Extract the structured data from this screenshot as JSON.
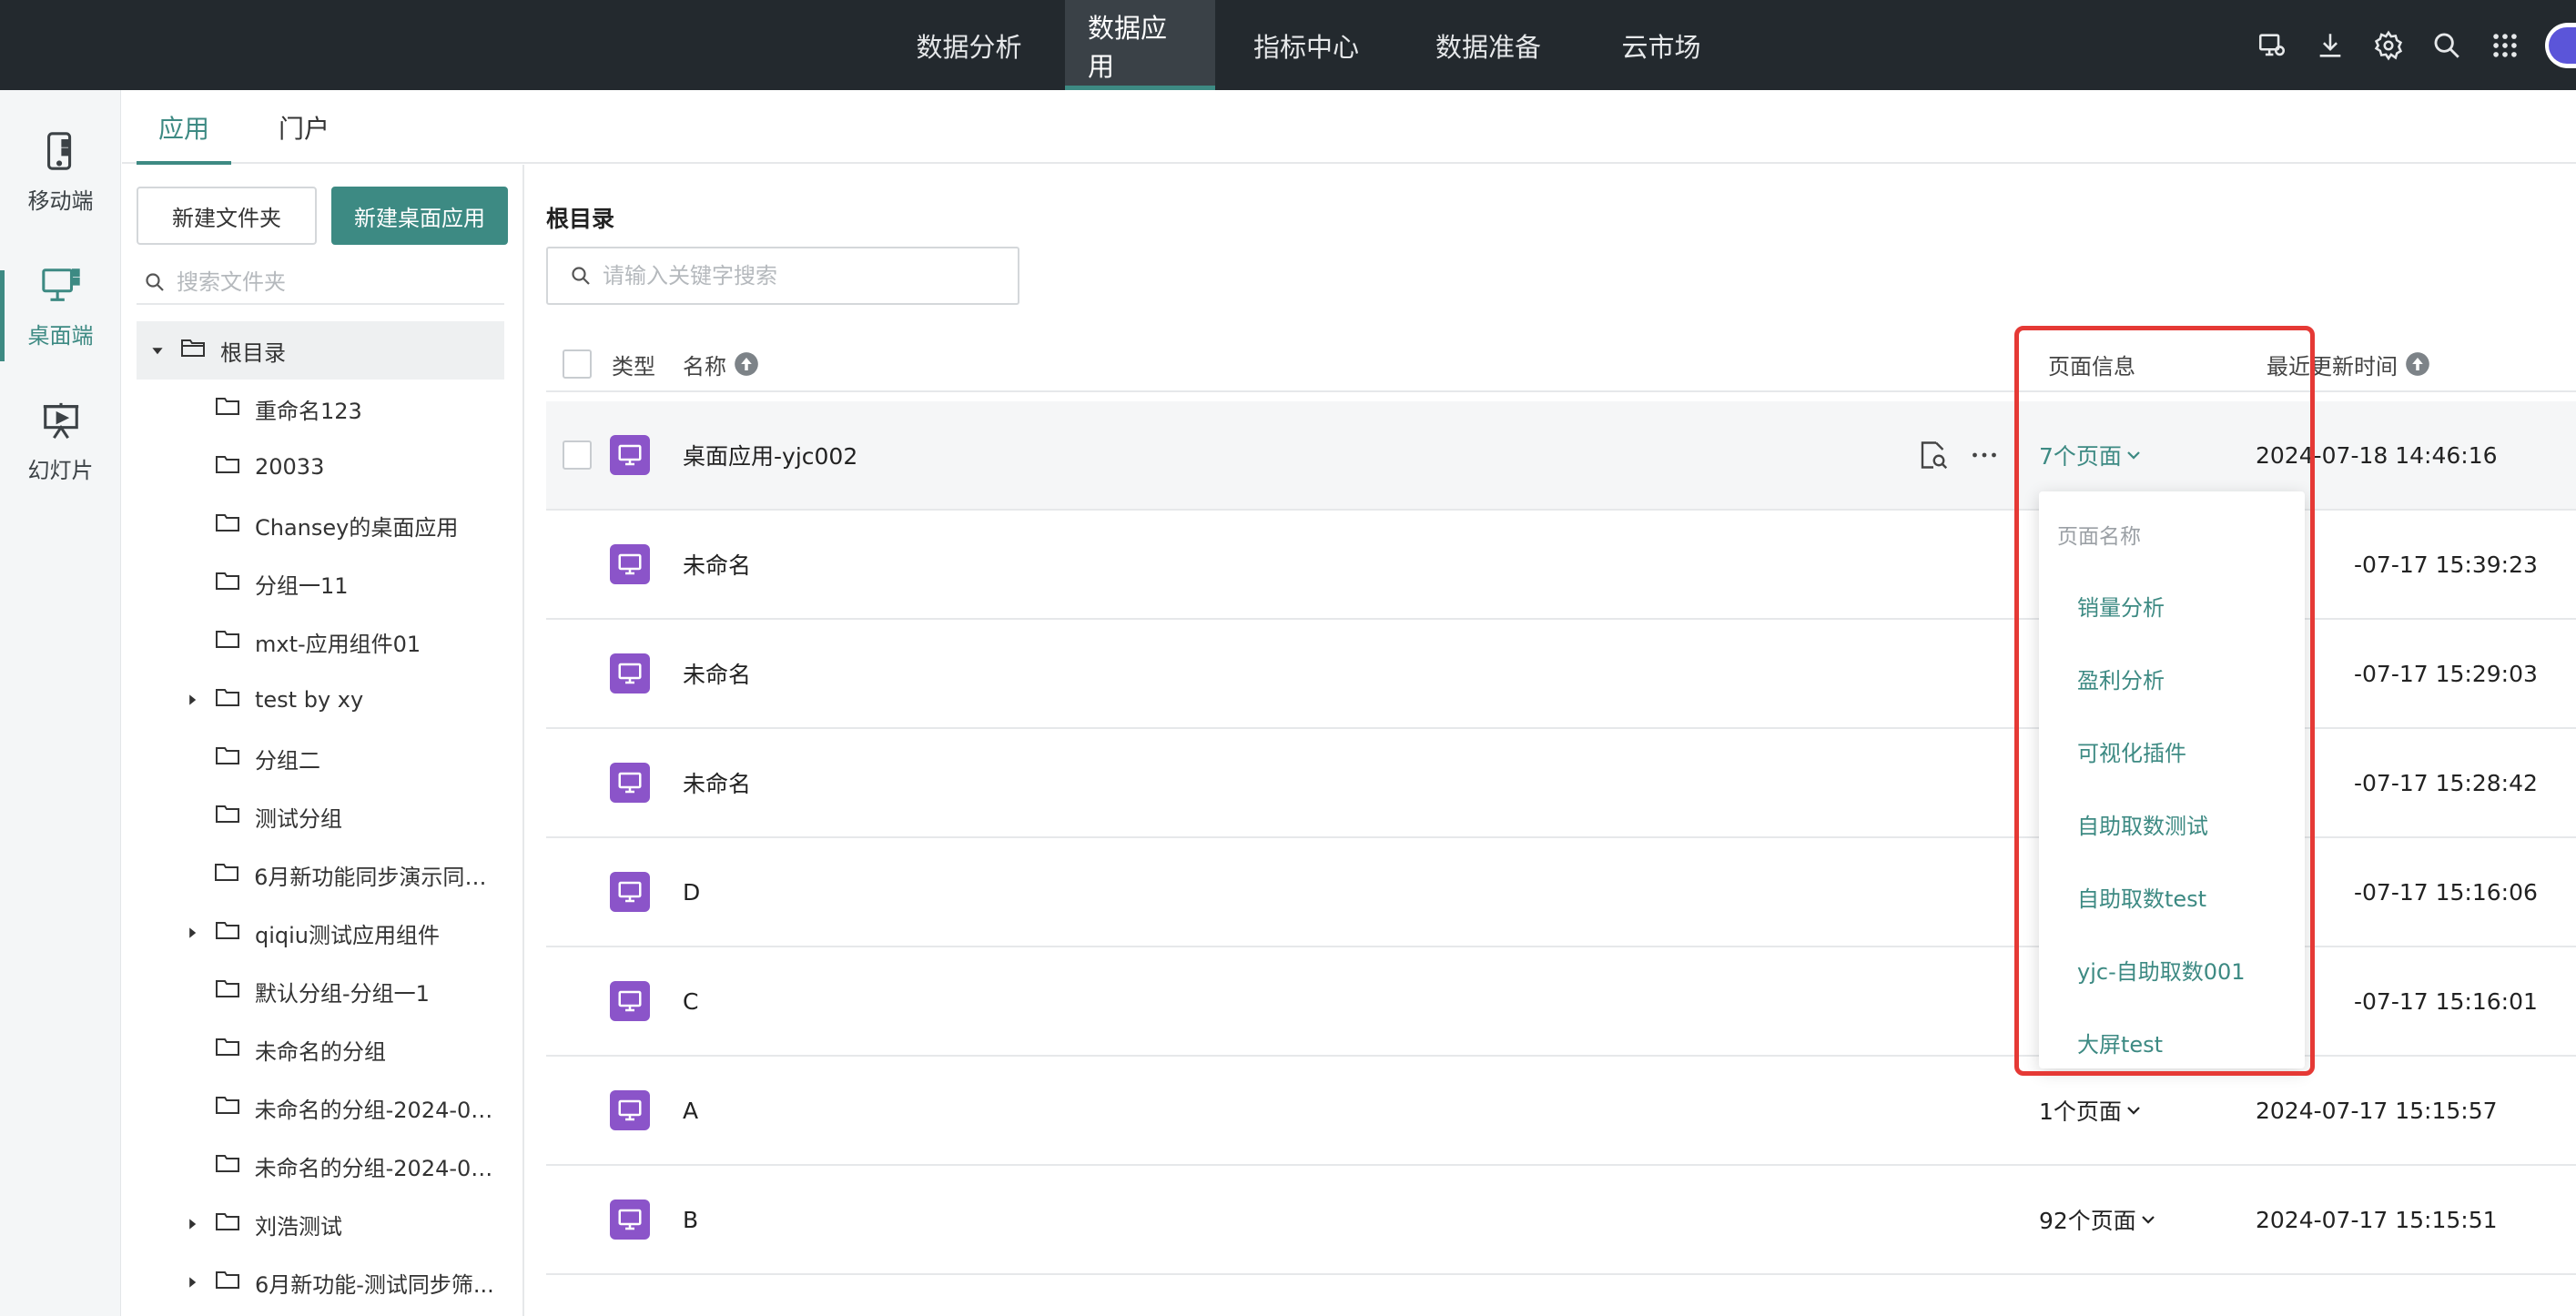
{
  "topbar": {
    "nav": [
      "数据分析",
      "数据应用",
      "指标中心",
      "数据准备",
      "云市场"
    ],
    "active_nav": "数据应用",
    "icons": [
      "monitor-settings-icon",
      "download-icon",
      "settings-icon",
      "search-icon",
      "apps-grid-icon",
      "avatar"
    ]
  },
  "rail": {
    "items": [
      {
        "label": "移动端",
        "icon": "mobile-icon"
      },
      {
        "label": "桌面端",
        "icon": "desktop-icon",
        "active": true
      },
      {
        "label": "幻灯片",
        "icon": "slideshow-icon"
      }
    ]
  },
  "subtabs": {
    "app": "应用",
    "portal": "门户",
    "active": "应用"
  },
  "folder_panel": {
    "new_folder_label": "新建文件夹",
    "new_desktop_app_label": "新建桌面应用",
    "search_placeholder": "搜索文件夹",
    "tree": [
      {
        "label": "根目录",
        "level": 0,
        "expanded": true,
        "selected": true
      },
      {
        "label": "重命名123",
        "level": 1
      },
      {
        "label": "20033",
        "level": 1
      },
      {
        "label": "Chansey的桌面应用",
        "level": 1
      },
      {
        "label": "分组一11",
        "level": 1
      },
      {
        "label": "mxt-应用组件01",
        "level": 1
      },
      {
        "label": "test by xy",
        "level": 1,
        "collapsed": true
      },
      {
        "label": "分组二",
        "level": 1
      },
      {
        "label": "测试分组",
        "level": 1
      },
      {
        "label": "6月新功能同步演示同步...",
        "level": 1
      },
      {
        "label": "qiqiu测试应用组件",
        "level": 1,
        "collapsed": true
      },
      {
        "label": "默认分组-分组一1",
        "level": 1
      },
      {
        "label": "未命名的分组",
        "level": 1
      },
      {
        "label": "未命名的分组-2024-06...",
        "level": 1
      },
      {
        "label": "未命名的分组-2024-06...",
        "level": 1
      },
      {
        "label": "刘浩测试",
        "level": 1,
        "collapsed": true
      },
      {
        "label": "6月新功能-测试同步筛...",
        "level": 1,
        "collapsed": true
      }
    ]
  },
  "main": {
    "breadcrumb": "根目录",
    "search_placeholder": "请输入关键字搜索",
    "columns": {
      "type": "类型",
      "name": "名称",
      "page_info": "页面信息",
      "updated": "最近更新时间"
    },
    "rows": [
      {
        "name": "桌面应用-yjc002",
        "pages": "7个页面",
        "updated": "2024-07-18 14:46:16",
        "hover": true
      },
      {
        "name": "未命名",
        "pages": "",
        "updated": "-07-17 15:39:23"
      },
      {
        "name": "未命名",
        "pages": "",
        "updated": "-07-17 15:29:03"
      },
      {
        "name": "未命名",
        "pages": "",
        "updated": "-07-17 15:28:42"
      },
      {
        "name": "D",
        "pages": "",
        "updated": "-07-17 15:16:06"
      },
      {
        "name": "C",
        "pages": "",
        "updated": "-07-17 15:16:01"
      },
      {
        "name": "A",
        "pages": "1个页面",
        "updated": "2024-07-17 15:15:57"
      },
      {
        "name": "B",
        "pages": "92个页面",
        "updated": "2024-07-17 15:15:51"
      }
    ],
    "dropdown": {
      "header": "页面名称",
      "items": [
        "销量分析",
        "盈利分析",
        "可视化插件",
        "自助取数测试",
        "自助取数test",
        "yjc-自助取数001",
        "大屏test"
      ]
    }
  },
  "colors": {
    "accent": "#3d8a83",
    "topbar": "#23292e",
    "app_icon": "#8b54c9",
    "highlight": "#e53935"
  }
}
